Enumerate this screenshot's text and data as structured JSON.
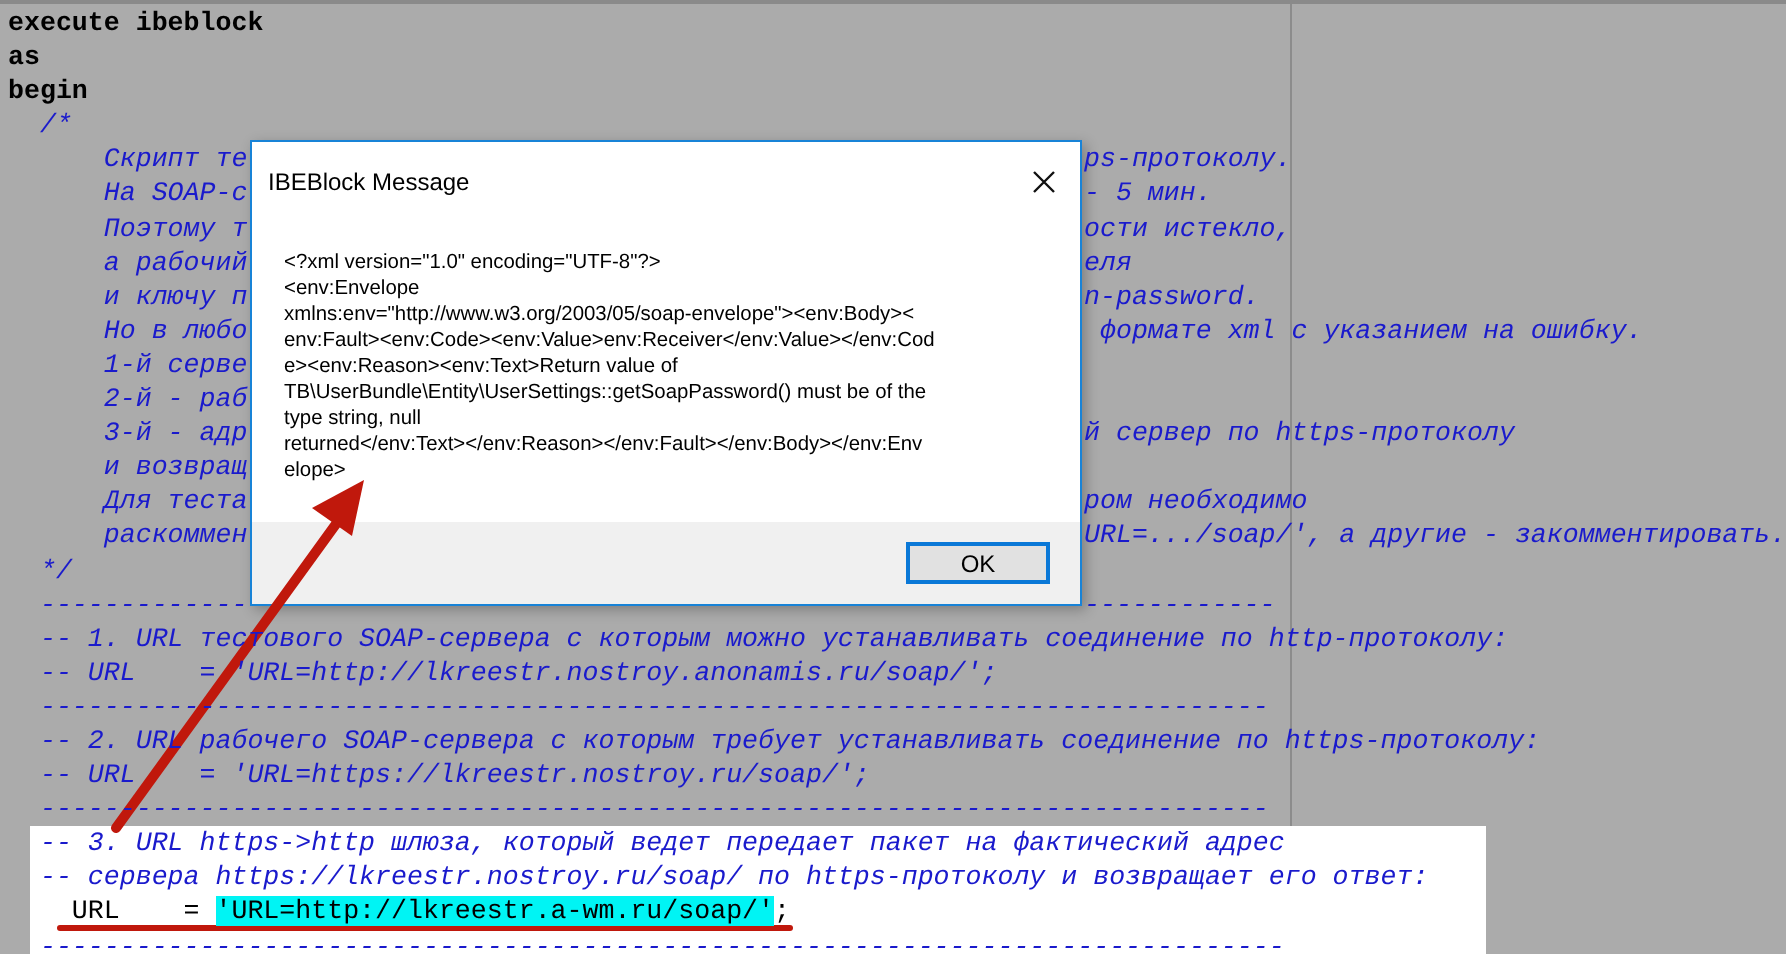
{
  "editor": {
    "lines": [
      {
        "kind": "keyword",
        "text": "execute ibeblock",
        "selected": false
      },
      {
        "kind": "keyword",
        "text": "as",
        "selected": false
      },
      {
        "kind": "keyword",
        "text": "begin",
        "selected": false
      },
      {
        "kind": "comment",
        "text": "  /*",
        "selected": false
      },
      {
        "kind": "comment",
        "text": "      Скрипт те",
        "tail": "ps-протоколу.",
        "selected": false
      },
      {
        "kind": "comment",
        "text": "      На SOAP-с",
        "tail": "- 5 мин.",
        "selected": false
      },
      {
        "kind": "comment",
        "text": "      Поэтому т",
        "tail": "ости истекло,",
        "selected": false
      },
      {
        "kind": "comment",
        "text": "      а рабочий",
        "tail": "еля",
        "selected": false
      },
      {
        "kind": "comment",
        "text": "      и ключу п",
        "tail": "n-password.",
        "selected": false
      },
      {
        "kind": "comment",
        "text": "      Но в любо",
        "tail": " формате xml с указанием на ошибку.",
        "selected": false
      },
      {
        "kind": "comment",
        "text": "      1-й серве",
        "selected": false
      },
      {
        "kind": "comment",
        "text": "      2-й - раб",
        "selected": false
      },
      {
        "kind": "comment",
        "text": "      3-й - адр",
        "tail": "й сервер по https-протоколу",
        "selected": false
      },
      {
        "kind": "comment",
        "text": "      и возвращ",
        "selected": false
      },
      {
        "kind": "comment",
        "text": "      Для теста",
        "tail": "ром необходимо",
        "selected": false
      },
      {
        "kind": "comment",
        "text": "      раскоммен",
        "tail": "URL=.../soap/', а другие - закомментировать.",
        "selected": false
      },
      {
        "kind": "comment",
        "text": "  */",
        "selected": false
      },
      {
        "kind": "comment",
        "text": "  -------------",
        "tail": "------------",
        "selected": false
      },
      {
        "kind": "comment",
        "text": "  -- 1. URL тестового SOAP-сервера с которым можно устанавливать соединение по http-протоколу:",
        "selected": false
      },
      {
        "kind": "comment",
        "text": "  -- URL    = 'URL=http://lkreestr.nostroy.anonamis.ru/soap/';",
        "selected": false
      },
      {
        "kind": "comment",
        "text": "  -----------------------------------------------------------------------------",
        "selected": false
      },
      {
        "kind": "comment",
        "text": "  -- 2. URL рабочего SOAP-сервера с которым требует устанавливать соединение по https-протоколу:",
        "selected": false
      },
      {
        "kind": "comment",
        "text": "  -- URL    = 'URL=https://lkreestr.nostroy.ru/soap/';",
        "selected": false
      },
      {
        "kind": "comment",
        "text": "  -----------------------------------------------------------------------------",
        "selected": false
      },
      {
        "kind": "comment",
        "text": "  -- 3. URL https->http шлюза, который ведет передает пакет на фактический адрес",
        "selected": true
      },
      {
        "kind": "comment",
        "text": "  -- сервера https://lkreestr.nostroy.ru/soap/ по https-протоколу и возвращает его ответ:",
        "selected": true
      },
      {
        "kind": "highlighted",
        "text": "    URL    = ",
        "highlighted": "'URL=http://lkreestr.a-wm.ru/soap/'",
        "rest": ";",
        "selected": true
      },
      {
        "kind": "comment",
        "text": "  ------------------------------------------------------------------------------",
        "selected": true
      }
    ]
  },
  "dialog": {
    "title": "IBEBlock Message",
    "message": "<?xml version=\"1.0\" encoding=\"UTF-8\"?>\n<env:Envelope\nxmlns:env=\"http://www.w3.org/2003/05/soap-envelope\"><env:Body><\nenv:Fault><env:Code><env:Value>env:Receiver</env:Value></env:Cod\ne><env:Reason><env:Text>Return value of\nTB\\UserBundle\\Entity\\UserSettings::getSoapPassword() must be of the\ntype string, null\nreturned</env:Text></env:Reason></env:Fault></env:Body></env:Env\nelope>",
    "buttons": [
      "OK"
    ]
  }
}
